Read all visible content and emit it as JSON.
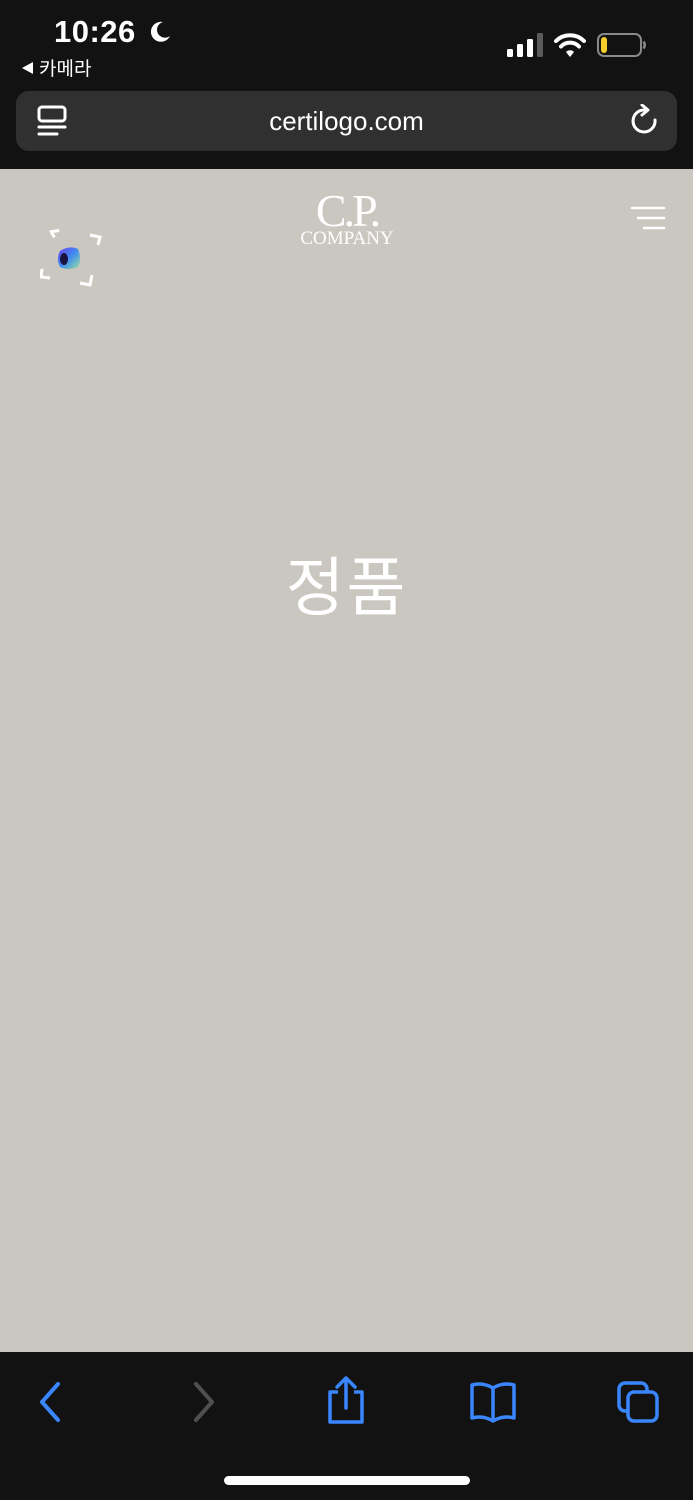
{
  "status_bar": {
    "time": "10:26",
    "back_app_label": "카메라",
    "icons": [
      "moon-icon",
      "signal-icon",
      "wifi-icon",
      "battery-icon"
    ],
    "battery_level": 0.15,
    "battery_color": "#f5d02a"
  },
  "browser": {
    "url": "certilogo.com",
    "icons": [
      "reader-icon",
      "reload-icon"
    ],
    "toolbar": {
      "icons": [
        "back-icon",
        "forward-icon",
        "share-icon",
        "bookmarks-icon",
        "tabs-icon"
      ],
      "accent_color": "#3a86ff",
      "disabled_color": "#4f4f4f"
    }
  },
  "page": {
    "background_color": "#cac7c0",
    "logo": {
      "line1": "C.P.",
      "line2": "COMPANY"
    },
    "verdict": "정품",
    "icons": [
      "scan-icon",
      "menu-icon"
    ]
  }
}
